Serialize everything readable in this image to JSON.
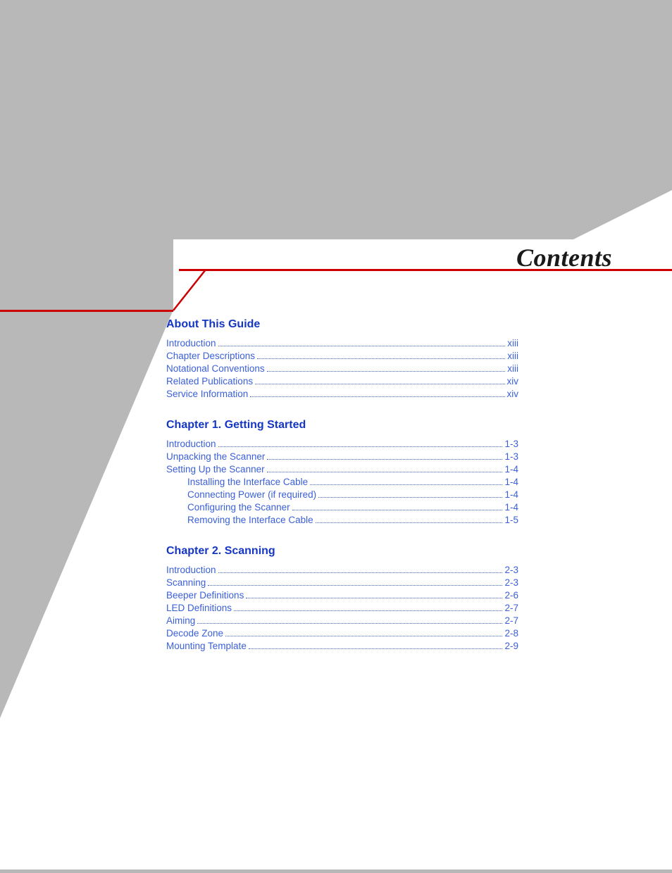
{
  "title": "Contents",
  "sections": [
    {
      "heading": "About This Guide",
      "entries": [
        {
          "label": "Introduction",
          "page": "xiii",
          "indent": false
        },
        {
          "label": "Chapter Descriptions",
          "page": "xiii",
          "indent": false
        },
        {
          "label": "Notational Conventions",
          "page": "xiii",
          "indent": false
        },
        {
          "label": "Related Publications",
          "page": "xiv",
          "indent": false
        },
        {
          "label": "Service Information",
          "page": "xiv",
          "indent": false
        }
      ]
    },
    {
      "heading": "Chapter 1. Getting Started",
      "entries": [
        {
          "label": "Introduction",
          "page": "1-3",
          "indent": false
        },
        {
          "label": "Unpacking the Scanner",
          "page": "1-3",
          "indent": false
        },
        {
          "label": "Setting Up the Scanner",
          "page": "1-4",
          "indent": false
        },
        {
          "label": "Installing the Interface Cable",
          "page": "1-4",
          "indent": true
        },
        {
          "label": "Connecting Power (if required)",
          "page": "1-4",
          "indent": true
        },
        {
          "label": "Configuring the Scanner",
          "page": "1-4",
          "indent": true
        },
        {
          "label": "Removing the Interface Cable",
          "page": "1-5",
          "indent": true
        }
      ]
    },
    {
      "heading": "Chapter 2. Scanning",
      "entries": [
        {
          "label": "Introduction",
          "page": "2-3",
          "indent": false
        },
        {
          "label": "Scanning",
          "page": "2-3",
          "indent": false
        },
        {
          "label": "Beeper Definitions",
          "page": "2-6",
          "indent": false
        },
        {
          "label": "LED Definitions",
          "page": "2-7",
          "indent": false
        },
        {
          "label": "Aiming",
          "page": "2-7",
          "indent": false
        },
        {
          "label": "Decode Zone",
          "page": "2-8",
          "indent": false
        },
        {
          "label": "Mounting Template",
          "page": "2-9",
          "indent": false
        }
      ]
    }
  ]
}
